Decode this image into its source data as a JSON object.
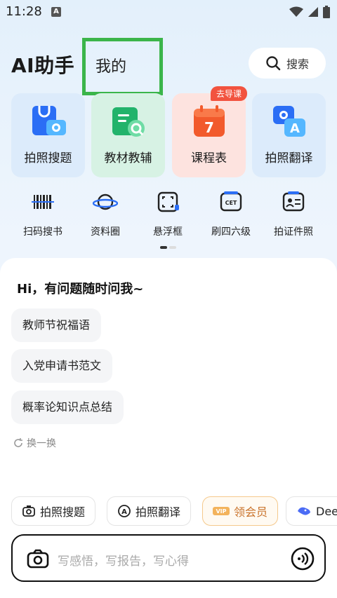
{
  "status": {
    "time": "11:28",
    "app_badge": "A"
  },
  "header": {
    "title": "AI助手",
    "tab_mine": "我的",
    "search_label": "搜索"
  },
  "cards": [
    {
      "label": "拍照搜题",
      "bg": "#dcebfb"
    },
    {
      "label": "教材教辅",
      "bg": "#d7f2e4"
    },
    {
      "label": "课程表",
      "bg": "#fde3df",
      "badge": "去导课"
    },
    {
      "label": "拍照翻译",
      "bg": "#dcebfb"
    }
  ],
  "tools": [
    {
      "label": "扫码搜书",
      "icon": "barcode-icon"
    },
    {
      "label": "资料圈",
      "icon": "planet-icon"
    },
    {
      "label": "悬浮框",
      "icon": "float-frame-icon"
    },
    {
      "label": "刷四六级",
      "icon": "cet-icon"
    },
    {
      "label": "拍证件照",
      "icon": "id-photo-icon"
    }
  ],
  "chat": {
    "greeting": "Hi，有问题随时问我~",
    "suggestions": [
      "教师节祝福语",
      "入党申请书范文",
      "概率论知识点总结"
    ],
    "refresh": "换一换"
  },
  "chips": [
    {
      "label": "拍照搜题",
      "icon": "camera-icon"
    },
    {
      "label": "拍照翻译",
      "icon": "translate-icon"
    },
    {
      "label": "领会员",
      "icon": "vip-icon"
    },
    {
      "label": "Dee",
      "icon": "deepseek-icon"
    }
  ],
  "input": {
    "placeholder": "写感悟，写报告，写心得"
  },
  "colors": {
    "accent_green": "#3bb54a",
    "vip_orange": "#c9722a",
    "badge_red": "#f2533f"
  }
}
